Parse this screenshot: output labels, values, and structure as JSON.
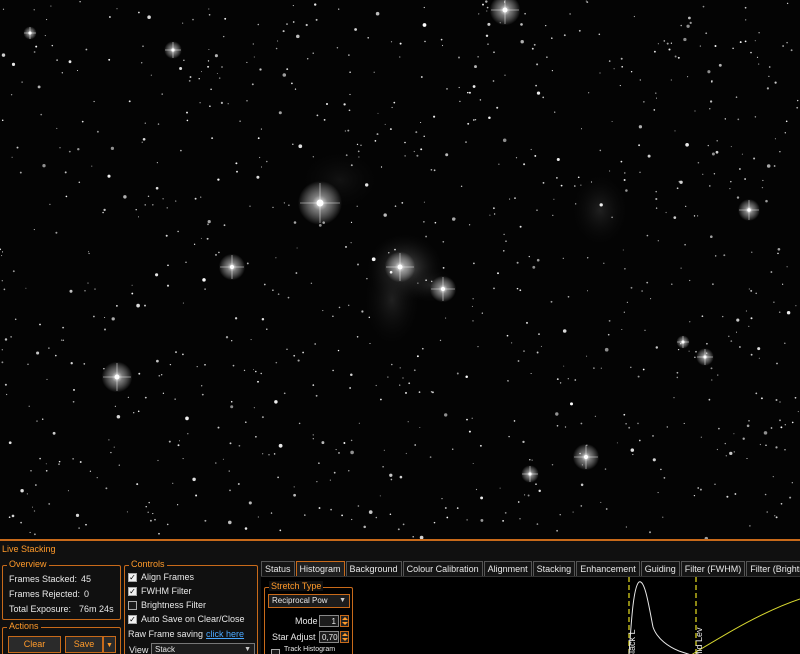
{
  "panel": {
    "title": "Live Stacking"
  },
  "overview": {
    "label": "Overview",
    "frames_stacked_label": "Frames Stacked:",
    "frames_stacked_value": "45",
    "frames_rejected_label": "Frames Rejected:",
    "frames_rejected_value": "0",
    "total_exposure_label": "Total Exposure:",
    "total_exposure_value": "76m 24s"
  },
  "actions": {
    "label": "Actions",
    "clear_label": "Clear",
    "save_label": "Save"
  },
  "controls": {
    "label": "Controls",
    "align_frames": "Align Frames",
    "align_frames_checked": true,
    "fwhm_filter": "FWHM Filter",
    "fwhm_filter_checked": true,
    "brightness_filter": "Brightness Filter",
    "brightness_filter_checked": false,
    "auto_save": "Auto Save on Clear/Close",
    "auto_save_checked": true,
    "raw_frame_saving": "Raw Frame saving",
    "raw_frame_link": "click here",
    "view_label": "View",
    "view_value": "Stack"
  },
  "tabs": [
    "Status",
    "Histogram",
    "Background",
    "Colour Calibration",
    "Alignment",
    "Stacking",
    "Enhancement",
    "Guiding",
    "Filter (FWHM)",
    "Filter (Brightne"
  ],
  "active_tab": "Histogram",
  "histogram": {
    "stretch_type_label": "Stretch Type",
    "stretch_type_value": "Reciprocal Pow",
    "mode_label": "Mode",
    "mode_value": "1",
    "star_adjust_label": "Star Adjust",
    "star_adjust_value": "0,70",
    "track_histogram_label": "Track Histogram",
    "black_level_marker": "Black L",
    "mid_level_marker": "Mid Lev"
  },
  "colors": {
    "accent": "#c86a1a",
    "accent_text": "#ff9a2a",
    "link": "#4aa8ff",
    "marker": "#e8e020",
    "curve": "#d8d830"
  }
}
